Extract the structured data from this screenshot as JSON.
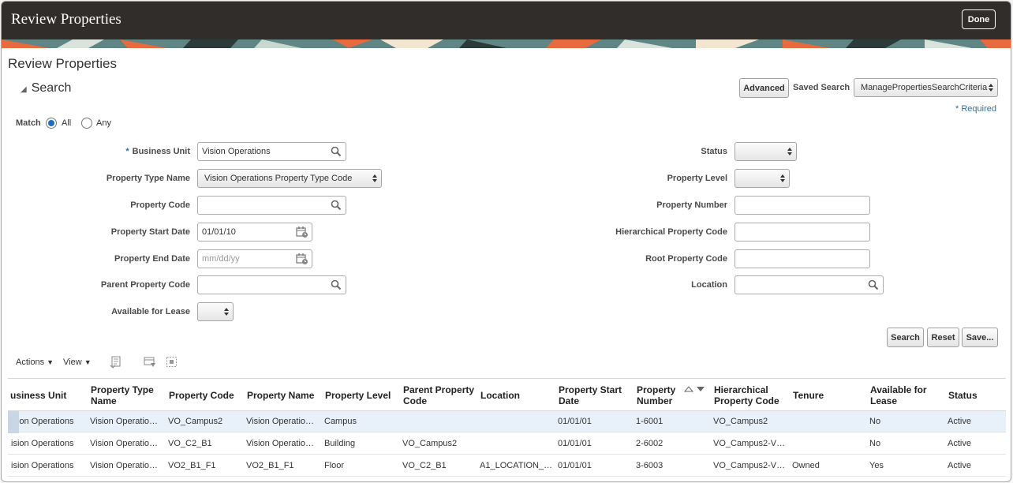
{
  "header": {
    "title": "Review Properties",
    "done_label": "Done"
  },
  "page": {
    "title": "Review Properties"
  },
  "search": {
    "title": "Search",
    "advanced_label": "Advanced",
    "saved_search_label": "Saved Search",
    "saved_search_value": "ManagePropertiesSearchCriteria",
    "required_star": "*",
    "required_label": "Required",
    "match_label": "Match",
    "match_all": "All",
    "match_any": "Any",
    "fields": {
      "business_unit": {
        "label": "Business Unit",
        "value": "Vision Operations"
      },
      "property_type_name": {
        "label": "Property Type Name",
        "value": "Vision Operations Property Type Code"
      },
      "property_code": {
        "label": "Property Code",
        "value": ""
      },
      "property_start_date": {
        "label": "Property Start Date",
        "value": "01/01/10"
      },
      "property_end_date": {
        "label": "Property End Date",
        "placeholder": "mm/dd/yy"
      },
      "parent_property_code": {
        "label": "Parent Property Code",
        "value": ""
      },
      "available_for_lease": {
        "label": "Available for Lease",
        "value": ""
      },
      "status": {
        "label": "Status",
        "value": ""
      },
      "property_level": {
        "label": "Property Level",
        "value": ""
      },
      "property_number": {
        "label": "Property Number",
        "value": ""
      },
      "hierarchical_property_code": {
        "label": "Hierarchical Property Code",
        "value": ""
      },
      "root_property_code": {
        "label": "Root Property Code",
        "value": ""
      },
      "location": {
        "label": "Location",
        "value": ""
      }
    },
    "search_btn": "Search",
    "reset_btn": "Reset",
    "save_btn": "Save..."
  },
  "toolbar": {
    "actions_label": "Actions",
    "view_label": "View"
  },
  "table": {
    "columns": [
      [
        "usiness Unit"
      ],
      [
        "Property Type",
        "Name"
      ],
      [
        "Property Code"
      ],
      [
        "Property Name"
      ],
      [
        "Property Level"
      ],
      [
        "Parent Property",
        "Code"
      ],
      [
        "Location"
      ],
      [
        "Property Start",
        "Date"
      ],
      [
        "Property",
        "Number"
      ],
      [
        "Hierarchical",
        "Property Code"
      ],
      [
        "Tenure"
      ],
      [
        "Available for",
        "Lease"
      ],
      [
        "Status"
      ]
    ],
    "rows": [
      [
        "ision Operations",
        "Vision Operatio…",
        "VO_Campus2",
        "Vision Operatio…",
        "Campus",
        "",
        "",
        "01/01/01",
        "1-6001",
        "VO_Campus2",
        "",
        "No",
        "Active"
      ],
      [
        "ision Operations",
        "Vision Operatio…",
        "VO_C2_B1",
        "Vision Operatio…",
        "Building",
        "VO_Campus2",
        "",
        "01/01/01",
        "2-6002",
        "VO_Campus2-V…",
        "",
        "No",
        "Active"
      ],
      [
        "ision Operations",
        "Vision Operatio…",
        "VO2_B1_F1",
        "VO2_B1_F1",
        "Floor",
        "VO_C2_B1",
        "A1_LOCATION_…",
        "01/01/01",
        "3-6003",
        "VO_Campus2-V…",
        "Owned",
        "Yes",
        "Active"
      ]
    ]
  },
  "colors": {
    "header_bg": "#312d2a",
    "accent": "#1e6fbf",
    "selected_row": "#e8f0fa"
  }
}
